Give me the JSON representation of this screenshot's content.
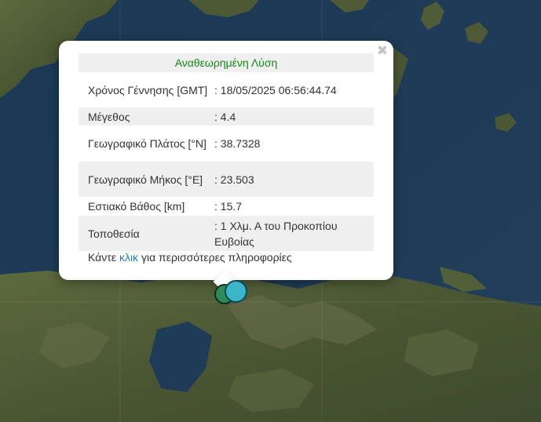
{
  "popup": {
    "header": "Αναθεωρημένη Λύση",
    "close_symbol": "✖",
    "rows": [
      {
        "label": "Χρόνος Γέννησης [GMT]",
        "value": ": 18/05/2025 06:56:44.74"
      },
      {
        "label": "Μέγεθος",
        "value": ": 4.4"
      },
      {
        "label": "Γεωγραφικό Πλάτος [°N]",
        "value": ": 38.7328"
      },
      {
        "label": "Γεωγραφικό Μήκος [°E]",
        "value": ": 23.503"
      },
      {
        "label": "Εστιακό Βάθος [km]",
        "value": ": 15.7"
      },
      {
        "label": "Τοποθεσία",
        "value": ": 1 Χλμ. Α του Προκοπίου Ευβοίας"
      }
    ],
    "more_prefix": "Κάντε",
    "more_link": "κλικ",
    "more_suffix": "για περισσότερες πληροφορίες"
  },
  "markers": [
    {
      "name": "earthquake-marker-green",
      "color": "#2e8b57"
    },
    {
      "name": "earthquake-marker-cyan",
      "color": "#3ab5c9"
    }
  ],
  "colors": {
    "sea": "#1d3a55",
    "land": "#4e5a36",
    "header_text": "#138a13",
    "link": "#1d7fc0"
  }
}
